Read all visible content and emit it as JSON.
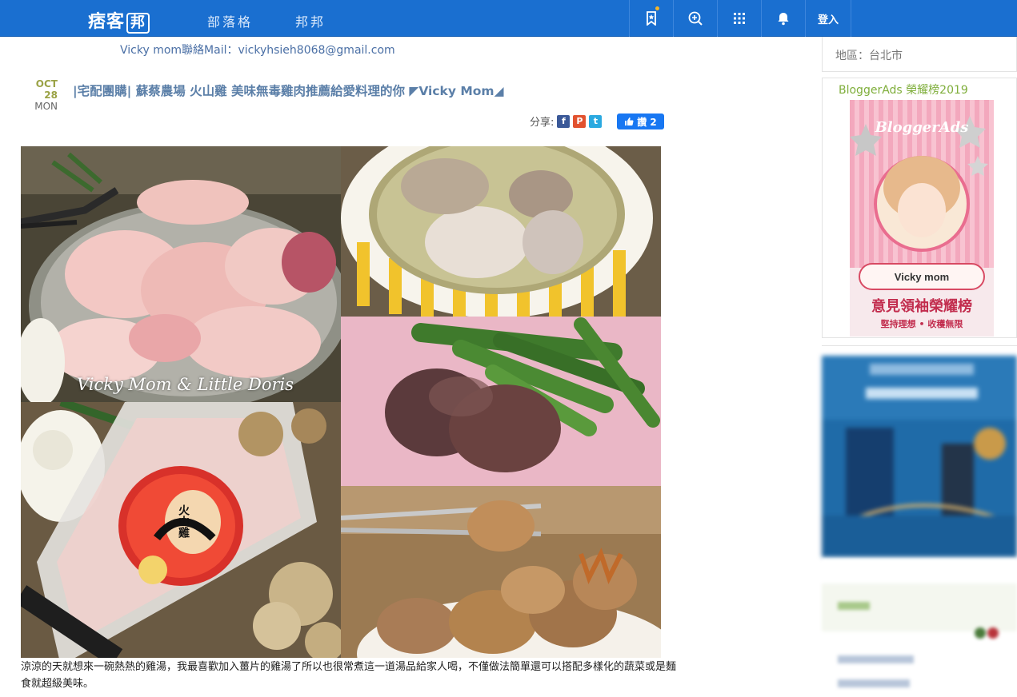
{
  "topbar": {
    "logo_text": "痞客",
    "logo_box": "邦",
    "nav": [
      "部落格",
      "邦邦"
    ],
    "login_label": "登入",
    "icons": [
      "bookmark-icon",
      "search-plus-icon",
      "apps-grid-icon",
      "bell-icon"
    ]
  },
  "contact": "Vicky mom聯絡Mail：vickyhsieh8068@gmail.com",
  "post": {
    "date_md": "OCT 28",
    "date_wd": "MON",
    "title": "|宅配團購| 蘇蔡農場 火山雞 美味無毒雞肉推薦給愛料理的你 ◤Vicky Mom◢",
    "share_label": "分享:",
    "like_label": "讚 2",
    "watermark": "Vicky Mom & Little Doris",
    "body": "涼涼的天就想來一碗熱熱的雞湯，我最喜歡加入薑片的雞湯了所以也很常煮這一道湯品給家人喝，不僅做法簡單還可以搭配多樣化的蔬菜或是麵食就超級美味。",
    "package_label": "火山雞"
  },
  "sidebar": {
    "region": "地區：台北市",
    "ads_title": "BloggerAds 榮耀榜2019",
    "banner_brand": "BloggerAds",
    "banner_name": "Vicky mom",
    "banner_headline": "意見領袖榮耀榜",
    "banner_sub": "堅持理想 • 收穫無限"
  },
  "colors": {
    "topbar": "#1a6fd0",
    "date_month": "#9aa245",
    "title": "#5b7fa8",
    "ads_title": "#7fae3b"
  }
}
